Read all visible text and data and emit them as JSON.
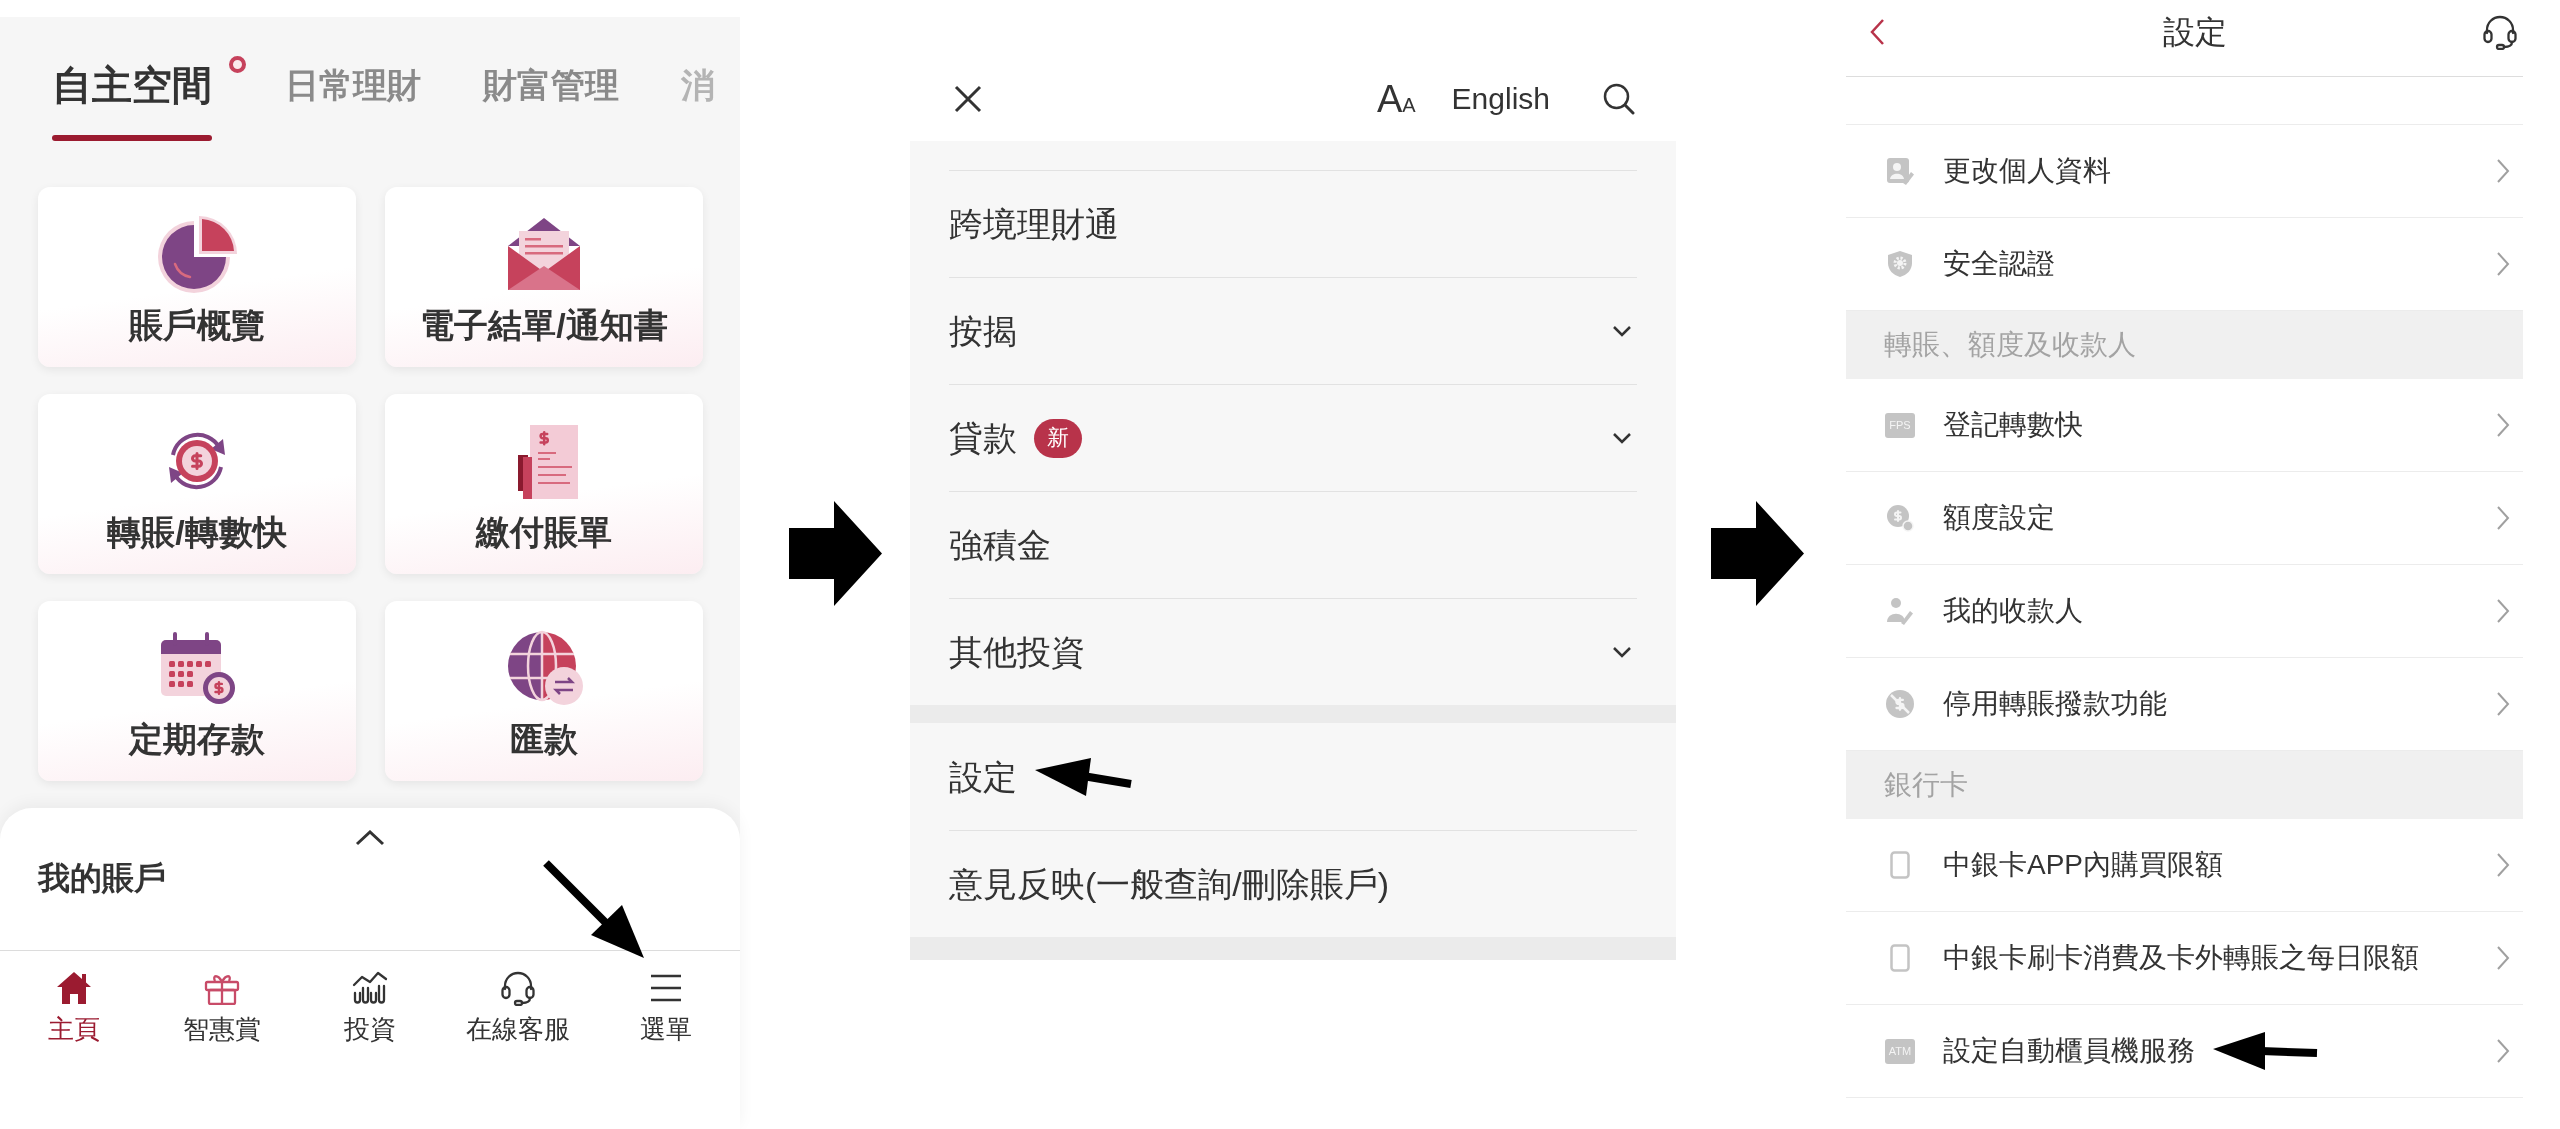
{
  "home_screen": {
    "tabs": [
      {
        "label": "自主空間",
        "selected": true,
        "notification": true,
        "faded": false
      },
      {
        "label": "日常理財",
        "selected": false,
        "notification": false,
        "faded": false
      },
      {
        "label": "財富管理",
        "selected": false,
        "notification": false,
        "faded": false
      },
      {
        "label": "消",
        "selected": false,
        "notification": false,
        "faded": true
      }
    ],
    "tiles": [
      {
        "label": "賬戶概覽",
        "kind": "pie"
      },
      {
        "label": "電子結單/通知書",
        "kind": "envelope"
      },
      {
        "label": "轉賬/轉數快",
        "kind": "transfer"
      },
      {
        "label": "繳付賬單",
        "kind": "bill"
      },
      {
        "label": "定期存款",
        "kind": "calendar"
      },
      {
        "label": "匯款",
        "kind": "globe"
      }
    ],
    "account_sheet": {
      "title": "我的賬戶",
      "expanded": false
    },
    "bottom_nav": [
      {
        "label": "主頁",
        "kind": "home",
        "selected": true
      },
      {
        "label": "智惠賞",
        "kind": "gift",
        "selected": false
      },
      {
        "label": "投資",
        "kind": "invest",
        "selected": false
      },
      {
        "label": "在線客服",
        "kind": "headset",
        "selected": false
      },
      {
        "label": "選單",
        "kind": "menu",
        "selected": false
      }
    ]
  },
  "menu_screen": {
    "text_size_button": {
      "large": "A",
      "small": "A"
    },
    "language_button": "English",
    "groups": [
      {
        "items": [
          {
            "label": "跨境理財通",
            "expandable": false,
            "pointed": false
          },
          {
            "label": "按揭",
            "expandable": true,
            "pointed": false
          },
          {
            "label": "貸款",
            "badge": "新",
            "expandable": true,
            "pointed": false
          },
          {
            "label": "強積金",
            "expandable": false,
            "pointed": false
          },
          {
            "label": "其他投資",
            "expandable": true,
            "pointed": false
          }
        ]
      },
      {
        "items": [
          {
            "label": "設定",
            "expandable": false,
            "pointed": true
          },
          {
            "label": "意見反映(一般查詢/刪除賬戶)",
            "expandable": false,
            "pointed": false
          }
        ]
      }
    ]
  },
  "settings_screen": {
    "title": "設定",
    "sections": [
      {
        "items": [
          {
            "label": "更改個人資料",
            "kind": "profile-edit",
            "pointed": false
          },
          {
            "label": "安全認證",
            "kind": "shield",
            "pointed": false
          }
        ]
      },
      {
        "header": "轉賬、額度及收款人",
        "items": [
          {
            "label": "登記轉數快",
            "kind": "tile",
            "icon_text": "FPS",
            "pointed": false
          },
          {
            "label": "額度設定",
            "kind": "coin-gear",
            "pointed": false
          },
          {
            "label": "我的收款人",
            "kind": "payee",
            "pointed": false
          },
          {
            "label": "停用轉賬撥款功能",
            "kind": "no-dollar",
            "pointed": false
          }
        ]
      },
      {
        "header": "銀行卡",
        "items": [
          {
            "label": "中銀卡APP內購買限額",
            "kind": "phone",
            "pointed": false
          },
          {
            "label": "中銀卡刷卡消費及卡外轉賬之每日限額",
            "kind": "phone",
            "pointed": false
          },
          {
            "label": "設定自動櫃員機服務",
            "kind": "tile",
            "icon_text": "ATM",
            "pointed": true
          }
        ]
      }
    ]
  }
}
